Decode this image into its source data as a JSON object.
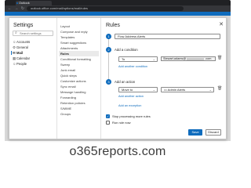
{
  "browser": {
    "tab_title": "Outlook",
    "address": "outlook.office.com/mail/options/mail/rules"
  },
  "settings": {
    "title": "Settings",
    "search_placeholder": "Search settings",
    "categories": [
      {
        "label": "Accounts",
        "icon": "person-icon"
      },
      {
        "label": "General",
        "icon": "gear-icon"
      },
      {
        "label": "Mail",
        "icon": "mail-icon"
      },
      {
        "label": "Calendar",
        "icon": "calendar-icon"
      },
      {
        "label": "People",
        "icon": "people-icon"
      }
    ],
    "active_category": "Mail"
  },
  "mail_menu": {
    "items": [
      "Layout",
      "Compose and reply",
      "Templates",
      "Smart suggestions",
      "Attachments",
      "Rules",
      "Conditional formatting",
      "Sweep",
      "Junk email",
      "Quick steps",
      "Customize actions",
      "Sync email",
      "Message handling",
      "Forwarding",
      "Retention policies",
      "S/MIME",
      "Groups"
    ],
    "active_item": "Rules"
  },
  "rules": {
    "title": "Rules",
    "rule_name": "Flow Address Alerts",
    "condition_label": "Add a condition",
    "condition_field": "To",
    "condition_value_prefix": "Stewart.adams@",
    "condition_value_suffix": ".com",
    "add_condition_link": "Add another condition",
    "action_label": "Add an action",
    "action_field": "Move to",
    "action_value": "Admin Alerts",
    "add_action_link": "Add another action",
    "add_exception_link": "Add an exception",
    "stop_processing_label": "Stop processing more rules",
    "stop_processing_checked": true,
    "run_rule_label": "Run rule now",
    "run_rule_checked": false,
    "save_label": "Save",
    "discard_label": "Discard"
  },
  "watermark": "o365reports.com",
  "colors": {
    "accent": "#0f6cbd",
    "header": "#0f6cbd"
  }
}
